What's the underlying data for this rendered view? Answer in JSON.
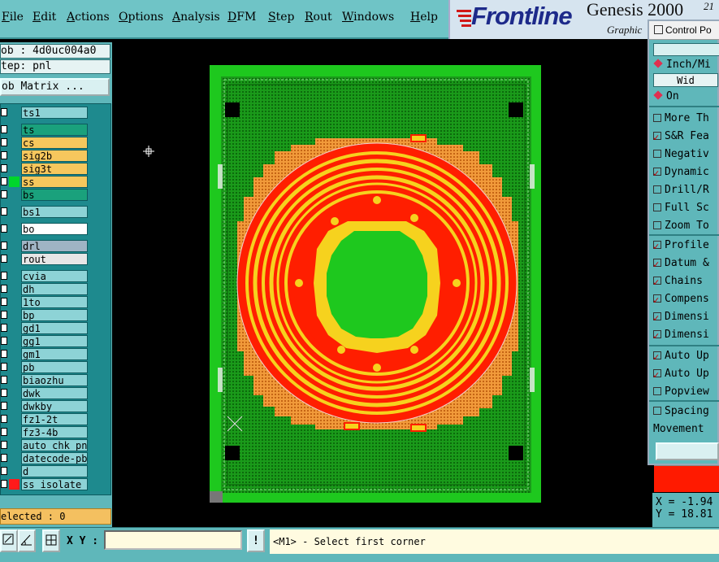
{
  "menubar": {
    "items": [
      "File",
      "Edit",
      "Actions",
      "Options",
      "Analysis",
      "DFM",
      "Step",
      "Rout",
      "Windows",
      "Help"
    ]
  },
  "logo": {
    "brand": "Frontline",
    "product": "Genesis 2000",
    "version": "21",
    "sub": "Graphic"
  },
  "left_panel": {
    "job": "ob : 4d0uc004a0",
    "step": "tep: pnl",
    "job_matrix": "ob Matrix ...",
    "selected": "elected : 0"
  },
  "layers": [
    {
      "name": "ts1",
      "color": "#8dd3d6",
      "swatch": "#1e8a8e"
    },
    {
      "name": "ts",
      "color": "#1aa17c",
      "swatch": "#1e8a8e"
    },
    {
      "name": "cs",
      "color": "#f6c75d",
      "swatch": "#1e8a8e"
    },
    {
      "name": "sig2b",
      "color": "#f6c75d",
      "swatch": "#1e8a8e"
    },
    {
      "name": "sig3t",
      "color": "#f6c75d",
      "swatch": "#1e8a8e"
    },
    {
      "name": "ss",
      "color": "#f6c75d",
      "swatch": "#00d62b"
    },
    {
      "name": "bs",
      "color": "#1aa17c",
      "swatch": "#1e8a8e"
    },
    {
      "name": "bs1",
      "color": "#8dd3d6",
      "swatch": "#1e8a8e"
    },
    {
      "name": "bo",
      "color": "#ffffff",
      "swatch": "#1e8a8e"
    },
    {
      "name": "drl",
      "color": "#9fb4c4",
      "swatch": "#1e8a8e"
    },
    {
      "name": "rout",
      "color": "#e6e6e6",
      "swatch": "#1e8a8e"
    },
    {
      "name": "cvia",
      "color": "#8dd3d6",
      "swatch": "#1e8a8e"
    },
    {
      "name": "dh",
      "color": "#8dd3d6",
      "swatch": "#1e8a8e"
    },
    {
      "name": "1to",
      "color": "#8dd3d6",
      "swatch": "#1e8a8e"
    },
    {
      "name": "bp",
      "color": "#8dd3d6",
      "swatch": "#1e8a8e"
    },
    {
      "name": "gd1",
      "color": "#8dd3d6",
      "swatch": "#1e8a8e"
    },
    {
      "name": "gg1",
      "color": "#8dd3d6",
      "swatch": "#1e8a8e"
    },
    {
      "name": "gm1",
      "color": "#8dd3d6",
      "swatch": "#1e8a8e"
    },
    {
      "name": "pb",
      "color": "#8dd3d6",
      "swatch": "#1e8a8e"
    },
    {
      "name": "biaozhu",
      "color": "#8dd3d6",
      "swatch": "#1e8a8e"
    },
    {
      "name": "dwk",
      "color": "#8dd3d6",
      "swatch": "#1e8a8e"
    },
    {
      "name": "dwkby",
      "color": "#8dd3d6",
      "swatch": "#1e8a8e"
    },
    {
      "name": "fz1-2t",
      "color": "#8dd3d6",
      "swatch": "#1e8a8e"
    },
    {
      "name": "fz3-4b",
      "color": "#8dd3d6",
      "swatch": "#1e8a8e"
    },
    {
      "name": "auto_chk_pn",
      "color": "#8dd3d6",
      "swatch": "#1e8a8e"
    },
    {
      "name": "datecode-pb",
      "color": "#8dd3d6",
      "swatch": "#1e8a8e"
    },
    {
      "name": "d",
      "color": "#8dd3d6",
      "swatch": "#1e8a8e"
    },
    {
      "name": "ss_isolate",
      "color": "#8dd3d6",
      "swatch": "#ff1a1a"
    }
  ],
  "control_panel": {
    "title": "Control Po",
    "units": "Inch/Mi",
    "width": "Wid",
    "on": "On",
    "options": [
      {
        "label": "More Th",
        "checked": false
      },
      {
        "label": "S&R Fea",
        "checked": true
      },
      {
        "label": "Negativ",
        "checked": false
      },
      {
        "label": "Dynamic",
        "checked": true
      },
      {
        "label": "Drill/R",
        "checked": false
      },
      {
        "label": "Full Sc",
        "checked": false
      },
      {
        "label": "Zoom To",
        "checked": false
      }
    ],
    "options2": [
      {
        "label": "Profile",
        "checked": true
      },
      {
        "label": "Datum &",
        "checked": true
      },
      {
        "label": "Chains",
        "checked": true
      },
      {
        "label": "Compens",
        "checked": true
      },
      {
        "label": "Dimensi",
        "checked": true
      },
      {
        "label": "Dimensi",
        "checked": true
      }
    ],
    "options3": [
      {
        "label": "Auto Up",
        "checked": true
      },
      {
        "label": "Auto Up",
        "checked": true
      },
      {
        "label": "Popview",
        "checked": false
      }
    ],
    "options4": [
      {
        "label": "Spacing",
        "checked": false
      }
    ],
    "movement": "Movement"
  },
  "coords": {
    "x": "X = -1.94",
    "y": "Y = 18.81"
  },
  "statusbar": {
    "xy_label": "X Y :",
    "xy_value": "",
    "warn": "!",
    "message": "<M1> - Select first corner"
  },
  "colors": {
    "board_green": "#1ec81e",
    "dark_green": "#138a13",
    "red": "#ff1e00",
    "yellow": "#f6d21e",
    "orange": "#f19a3a"
  }
}
